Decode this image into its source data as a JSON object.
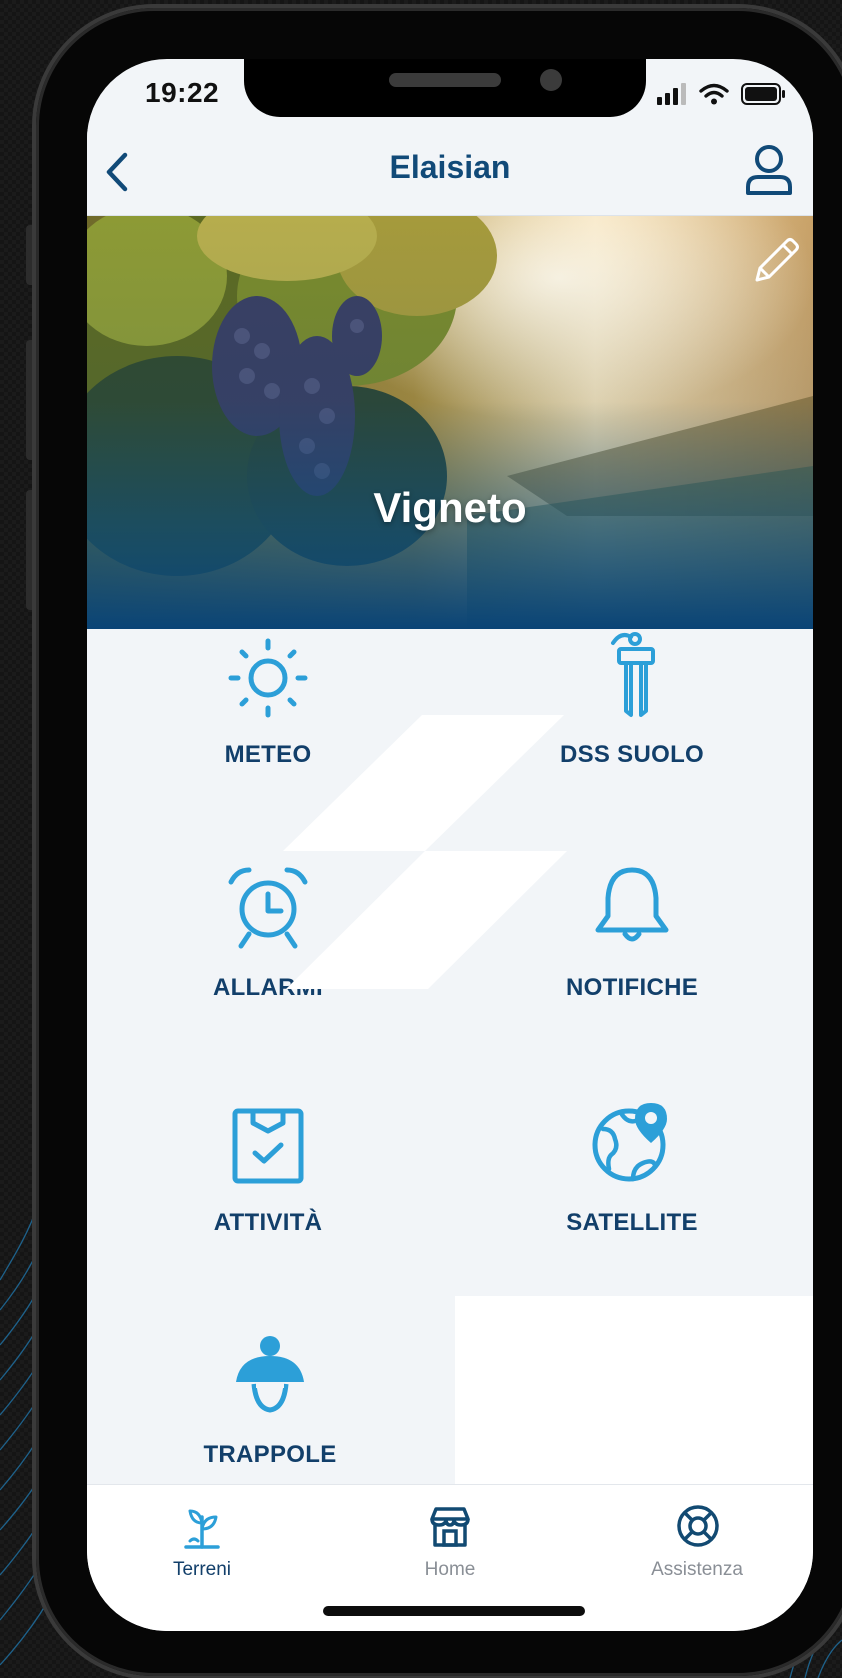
{
  "status_bar": {
    "time": "19:22",
    "signal_icon": "cellular-signal-icon",
    "wifi_icon": "wifi-icon",
    "battery_icon": "battery-icon"
  },
  "nav": {
    "title": "Elaisian",
    "back_icon": "chevron-left-icon",
    "profile_icon": "user-profile-icon"
  },
  "hero": {
    "title": "Vigneto",
    "edit_icon": "pencil-icon"
  },
  "tiles": [
    {
      "label": "METEO",
      "icon": "sun-icon"
    },
    {
      "label": "DSS SUOLO",
      "icon": "soil-sensor-icon"
    },
    {
      "label": "ALLARMI",
      "icon": "alarm-clock-icon"
    },
    {
      "label": "NOTIFICHE",
      "icon": "bell-icon"
    },
    {
      "label": "ATTIVITÀ",
      "icon": "clipboard-check-icon"
    },
    {
      "label": "SATELLITE",
      "icon": "globe-pin-icon"
    },
    {
      "label": "TRAPPOLE",
      "icon": "insect-trap-icon"
    }
  ],
  "tabbar": {
    "tabs": [
      {
        "label": "Terreni",
        "icon": "sprout-icon",
        "active": true
      },
      {
        "label": "Home",
        "icon": "shop-icon",
        "active": false
      },
      {
        "label": "Assistenza",
        "icon": "lifebuoy-icon",
        "active": false
      }
    ]
  },
  "colors": {
    "accent": "#2c9fd8",
    "title_blue": "#114a78",
    "label_blue": "#123f6a",
    "tile_bg": "#f2f5f8",
    "tab_inactive": "#8a8f96"
  }
}
